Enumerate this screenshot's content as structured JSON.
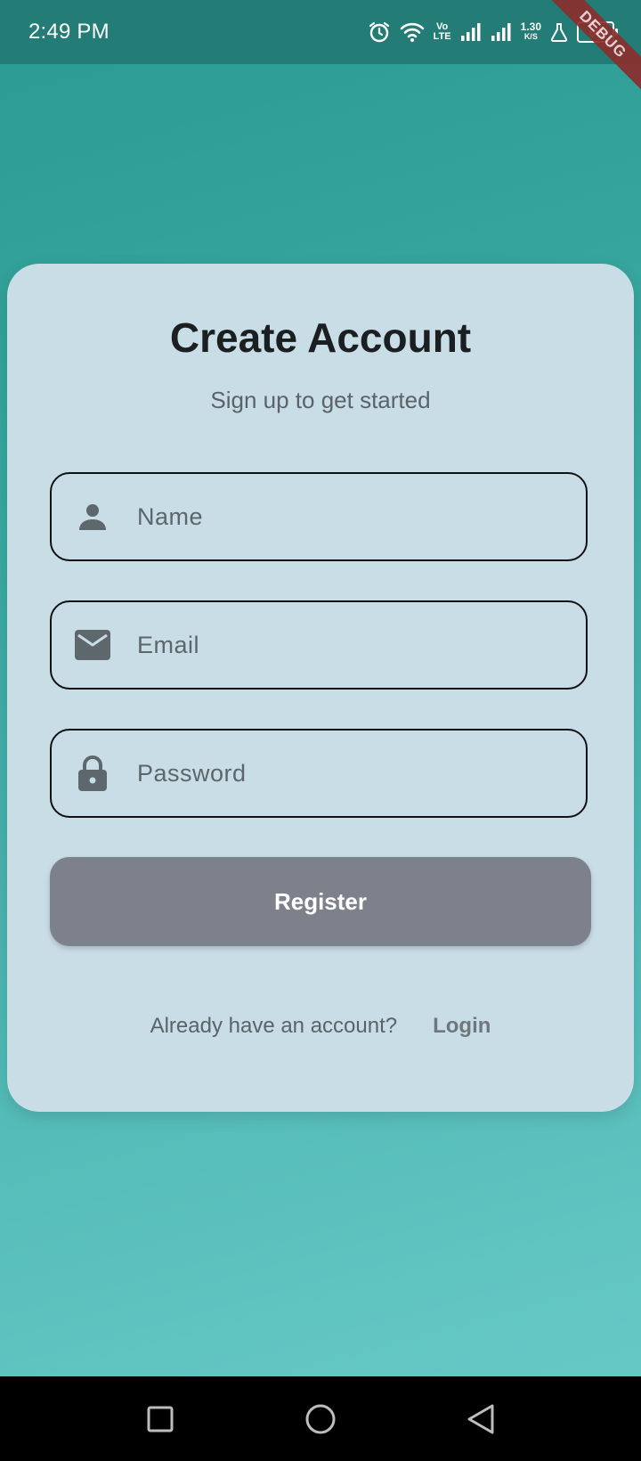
{
  "status_bar": {
    "time": "2:49 PM",
    "net_speed_top": "1.30",
    "net_speed_bottom": "K/S",
    "volte_top": "Vo",
    "volte_bottom": "LTE",
    "battery": "69",
    "icons": [
      "alarm-icon",
      "wifi-icon",
      "volte-icon",
      "signal-icon",
      "signal-icon",
      "net-speed",
      "flask-icon",
      "battery-icon"
    ]
  },
  "debug_banner": "DEBUG",
  "form": {
    "title": "Create Account",
    "subtitle": "Sign up to get started",
    "fields": [
      {
        "icon": "person-icon",
        "placeholder": "Name",
        "value": ""
      },
      {
        "icon": "email-icon",
        "placeholder": "Email",
        "value": ""
      },
      {
        "icon": "lock-icon",
        "placeholder": "Password",
        "value": ""
      }
    ],
    "register_label": "Register",
    "footer_text": "Already have an account?",
    "login_label": "Login"
  },
  "nav_bar": {
    "icons": [
      "recents-square-icon",
      "home-circle-icon",
      "back-triangle-icon"
    ]
  },
  "colors": {
    "accent": "#2e9e97",
    "card": "#c9dde6",
    "button": "#7c818b",
    "status_bar": "#237c76"
  }
}
